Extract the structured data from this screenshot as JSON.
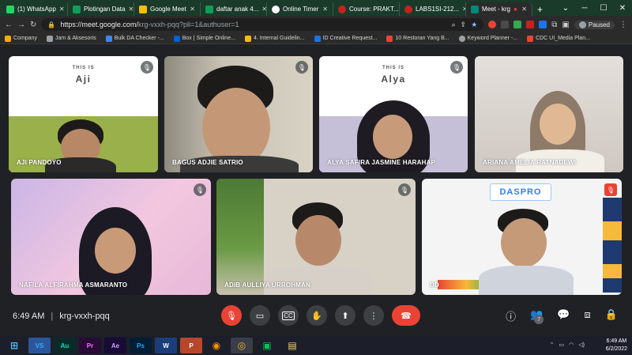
{
  "browser": {
    "tabs": [
      {
        "label": "(1) WhatsApp",
        "color": "#25d366"
      },
      {
        "label": "Plotingan Data",
        "color": "#0f9d58"
      },
      {
        "label": "Google Meet",
        "color": "#fbbc04"
      },
      {
        "label": "daftar anak 4...",
        "color": "#0f9d58"
      },
      {
        "label": "Online Timer",
        "color": "#ffffff"
      },
      {
        "label": "Course: PRAKT...",
        "color": "#c5221f"
      },
      {
        "label": "LABS1SI-212...",
        "color": "#c5221f"
      },
      {
        "label": "Meet - krg",
        "color": "#00897b"
      }
    ],
    "new_tab": "+",
    "url_host": "https://meet.google.com/",
    "url_path": "krg-vxxh-pqq?pli=1&authuser=1",
    "profile_status": "Paused",
    "bookmarks": [
      {
        "label": "Company",
        "color": "#f9ab00"
      },
      {
        "label": "Jam & Aksesoris",
        "color": "#9aa0a6"
      },
      {
        "label": "Bulk DA Checker -...",
        "color": "#4285f4"
      },
      {
        "label": "Box | Simple Online...",
        "color": "#0061d5"
      },
      {
        "label": "4. Internal Guidelin...",
        "color": "#fbbc04"
      },
      {
        "label": "ID Creative Request...",
        "color": "#1a73e8"
      },
      {
        "label": "10 Restoran Yang B...",
        "color": "#ea4335"
      },
      {
        "label": "Keyword Planner -...",
        "color": "#9aa0a6"
      },
      {
        "label": "CDC UI_Media Plan...",
        "color": "#ea4335"
      }
    ]
  },
  "meet": {
    "participants": [
      {
        "name": "AJI PANDOYO",
        "this_is": "THIS IS",
        "frame_name": "Aji"
      },
      {
        "name": "BAGUS ADJIE SATRIO"
      },
      {
        "name": "ALYA SAFIRA JASMINE HARAHAP",
        "this_is": "THIS IS",
        "frame_name": "Alya"
      },
      {
        "name": "ARIANA AMELIA RATNADEWI"
      },
      {
        "name": "NAFILA ALFIRAHMA ASMARANTO"
      },
      {
        "name": "ADIB AULLIYA URROHMAN"
      },
      {
        "name": "DD",
        "banner": "DASPRO"
      }
    ],
    "time": "6:49 AM",
    "separator": "|",
    "meeting_code": "krg-vxxh-pqq",
    "people_count": "7"
  },
  "taskbar": {
    "apps": [
      {
        "label": "VS",
        "bg": "#2b579a",
        "fg": "#3ea6ff"
      },
      {
        "label": "Au",
        "bg": "#0a2a2a",
        "fg": "#00e4bb"
      },
      {
        "label": "Pr",
        "bg": "#2a0a36",
        "fg": "#e77cff"
      },
      {
        "label": "Ae",
        "bg": "#1a0a36",
        "fg": "#c7a4ff"
      },
      {
        "label": "Ps",
        "bg": "#001e36",
        "fg": "#31a8ff"
      },
      {
        "label": "W",
        "bg": "#1a3e7a",
        "fg": "#ffffff"
      },
      {
        "label": "P",
        "bg": "#b7472a",
        "fg": "#ffffff"
      }
    ],
    "clock_time": "6:49 AM",
    "clock_date": "6/2/2022"
  }
}
